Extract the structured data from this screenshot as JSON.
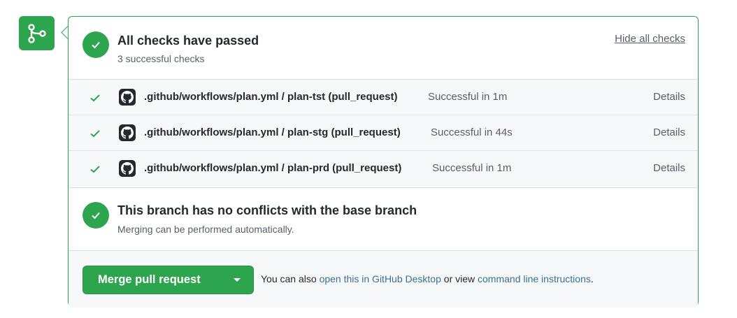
{
  "icons": {
    "merge_badge": "git-merge-icon",
    "status": "check-circle-icon",
    "row_check": "check-icon",
    "avatar": "github-logo-icon",
    "caret": "caret-down-icon"
  },
  "colors": {
    "success": "#2da44e",
    "text": "#24292f",
    "muted": "#57606a",
    "link": "#3b6f97"
  },
  "checks_summary": {
    "title": "All checks have passed",
    "subtitle": "3 successful checks",
    "hide_link": "Hide all checks"
  },
  "checks": [
    {
      "name": ".github/workflows/plan.yml / plan-tst (pull_request)",
      "status": "Successful in 1m",
      "details": "Details"
    },
    {
      "name": ".github/workflows/plan.yml / plan-stg (pull_request)",
      "status": "Successful in 44s",
      "details": "Details"
    },
    {
      "name": ".github/workflows/plan.yml / plan-prd (pull_request)",
      "status": "Successful in 1m",
      "details": "Details"
    }
  ],
  "conflicts": {
    "title": "This branch has no conflicts with the base branch",
    "subtitle": "Merging can be performed automatically."
  },
  "merge": {
    "button_label": "Merge pull request",
    "text_prefix": "You can also ",
    "desktop_link": "open this in GitHub Desktop",
    "text_middle": " or view ",
    "cli_link": "command line instructions",
    "text_suffix": "."
  }
}
